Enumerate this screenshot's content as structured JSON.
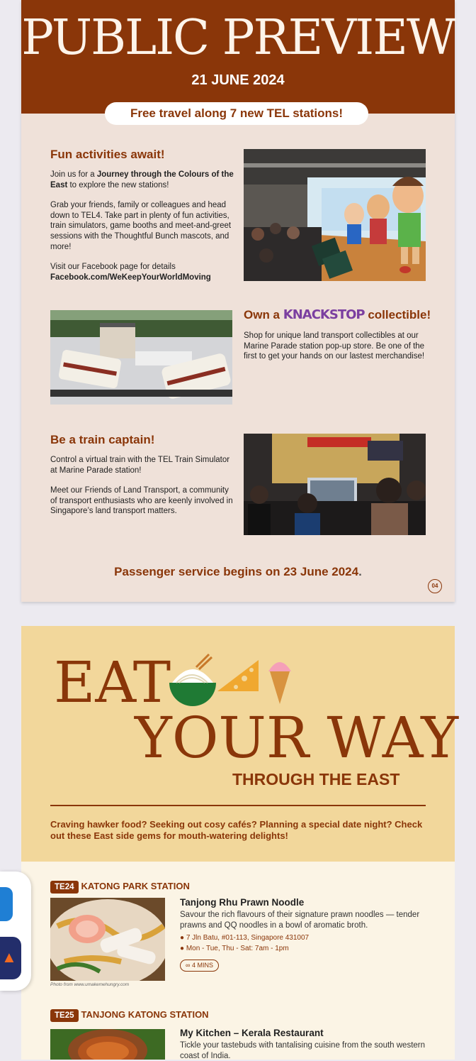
{
  "preview": {
    "title": "PUBLIC PREVIEW",
    "date": "21 JUNE 2024",
    "pill_highlight": "Free travel",
    "pill_rest": " along 7 new TEL stations!"
  },
  "activities": {
    "heading": "Fun activities await!",
    "p1_a": "Join us for a ",
    "p1_bold": "Journey through the Colours of the East",
    "p1_b": " to explore the new stations!",
    "p2": "Grab your friends, family or colleagues and head down to TEL4. Take part in plenty of fun activities, train simulators, game booths and meet-and-greet sessions with the Thoughtful Bunch mascots, and more!",
    "p3": "Visit our Facebook page for details",
    "p3_link": "Facebook.com/WeKeepYourWorldMoving"
  },
  "collectible": {
    "heading_a": "Own a",
    "brand": "KNACKSTOP",
    "heading_b": "collectible!",
    "text": "Shop for unique land transport collectibles at our Marine Parade station pop-up store. Be one of the first to get your hands on our lastest merchandise!"
  },
  "captain": {
    "heading": "Be a train captain!",
    "p1": "Control a virtual train with the TEL Train Simulator at Marine Parade station!",
    "p2": "Meet our Friends of Land Transport, a community of transport enthusiasts who are keenly involved in Singapore’s land transport matters."
  },
  "service": "Passenger service begins on 23 June 2024",
  "service_dot": ".",
  "page_number": "04",
  "eat": {
    "word1": "EAT",
    "word2": "YOUR WAY",
    "sub": "THROUGH THE EAST",
    "intro": "Craving hawker food? Seeking out cosy cafés? Planning a special date night? Check out these East side gems for mouth-watering delights!"
  },
  "stations": [
    {
      "code": "TE24",
      "name": "KATONG PARK STATION",
      "food": "Tanjong Rhu Prawn Noodle",
      "desc": "Savour the rich flavours of their signature prawn noodles — tender prawns and QQ noodles in a bowl of aromatic broth.",
      "address": "7 Jln Batu, #01-113, Singapore 431007",
      "hours": "Mon - Tue, Thu - Sat: 7am - 1pm",
      "mins": "4 MINS",
      "credit": "Photo from www.umakemehungry.com"
    },
    {
      "code": "TE25",
      "name": "TANJONG KATONG STATION",
      "food": "My Kitchen – Kerala Restaurant",
      "desc": "Tickle your tastebuds with tantalising cuisine from the south western coast of India."
    }
  ],
  "colors": {
    "brown": "#8a3609",
    "cream": "#efe1d9",
    "sand": "#f2d79b"
  },
  "icons": [
    "map-pin-icon",
    "clock-icon",
    "walk-icon",
    "noodle-bowl-icon",
    "cheese-icon",
    "ice-cream-icon"
  ]
}
